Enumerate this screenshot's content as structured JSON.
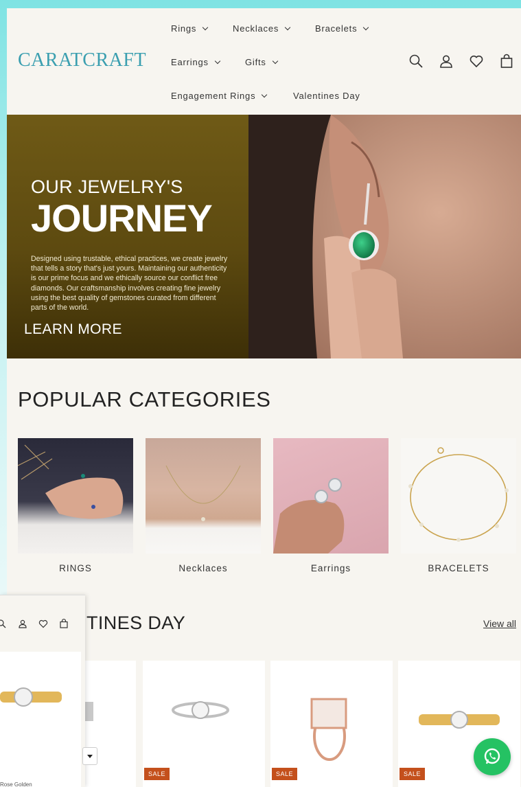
{
  "brand": {
    "logo": "CARATCRAFT",
    "accent": "#3b9fb0"
  },
  "nav": {
    "rings": "Rings",
    "necklaces": "Necklaces",
    "bracelets": "Bracelets",
    "earrings": "Earrings",
    "gifts": "Gifts",
    "engagement_rings": "Engagement Rings",
    "valentines_day": "Valentines Day"
  },
  "header_icons": [
    "search-icon",
    "account-icon",
    "wishlist-heart-icon",
    "cart-bag-icon"
  ],
  "hero": {
    "pretitle": "OUR JEWELRY'S",
    "title": "JOURNEY",
    "description": "Designed using trustable, ethical practices, we create jewelry that tells a story that's just yours. Maintaining our authenticity is our prime focus and we ethically source our conflict free diamonds. Our craftsmanship involves creating fine jewelry using the best quality of gemstones curated from different parts of the world.",
    "cta": "LEARN MORE",
    "bg_color": "#6f5a16"
  },
  "popular": {
    "title": "POPULAR CATEGORIES",
    "items": [
      {
        "label": "RINGS"
      },
      {
        "label": "Necklaces"
      },
      {
        "label": "Earrings"
      },
      {
        "label": "BRACELETS"
      }
    ]
  },
  "valentines": {
    "title_visible": "TINES DAY",
    "view_all": "View all",
    "sale_badge": "SALE",
    "badge_color": "#c4501c"
  },
  "overlay": {
    "product_text": "Rose Golden"
  },
  "whatsapp": {
    "icon": "whatsapp-icon",
    "color": "#25c263"
  }
}
